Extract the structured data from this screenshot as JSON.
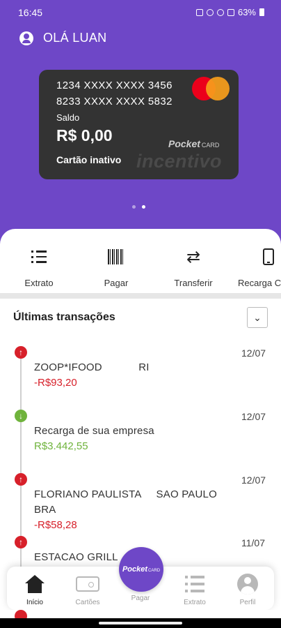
{
  "status_bar": {
    "time": "16:45",
    "battery": "63%"
  },
  "header": {
    "greeting": "OLÁ LUAN"
  },
  "card": {
    "number_1": "1234 XXXX XXXX 3456",
    "number_2": "8233 XXXX XXXX 5832",
    "balance_label": "Saldo",
    "balance": "R$ 0,00",
    "status": "Cartão inativo",
    "brand": "Pocket",
    "brand_suffix": "CARD",
    "watermark": "incentivo",
    "network": "mastercard-logo"
  },
  "carousel": {
    "pages": 2,
    "active_index": 1
  },
  "quick_actions": [
    {
      "label": "Extrato",
      "icon": "list-icon"
    },
    {
      "label": "Pagar",
      "icon": "barcode-icon"
    },
    {
      "label": "Transferir",
      "icon": "transfer-icon"
    },
    {
      "label": "Recarga Celular",
      "icon": "phone-icon"
    }
  ],
  "transactions": {
    "title": "Últimas transações",
    "toggle_icon": "chevron-down-icon",
    "items": [
      {
        "type": "out",
        "date": "12/07",
        "description": "ZOOP*IFOOD            RI",
        "amount": "-R$93,20"
      },
      {
        "type": "in",
        "date": "12/07",
        "description": "Recarga de sua empresa",
        "amount": "R$3.442,55"
      },
      {
        "type": "out",
        "date": "12/07",
        "description": "FLORIANO PAULISTA     SAO PAULO\nBRA",
        "amount": "-R$58,28"
      },
      {
        "type": "out",
        "date": "11/07",
        "description": "ESTACAO GRILL",
        "amount": ""
      }
    ]
  },
  "bottom_nav": {
    "items": [
      {
        "label": "Início",
        "icon": "home-icon",
        "active": true
      },
      {
        "label": "Cartões",
        "icon": "card-icon",
        "active": false
      },
      {
        "label": "Pagar",
        "icon": "pocket-card-logo",
        "active": false
      },
      {
        "label": "Extrato",
        "icon": "list-icon",
        "active": false
      },
      {
        "label": "Perfil",
        "icon": "profile-icon",
        "active": false
      }
    ],
    "fab_brand": "Pocket",
    "fab_suffix": "CARD"
  },
  "colors": {
    "primary": "#6e47c7",
    "debit": "#d7202a",
    "credit": "#6fb33c",
    "card_bg": "#333333"
  }
}
